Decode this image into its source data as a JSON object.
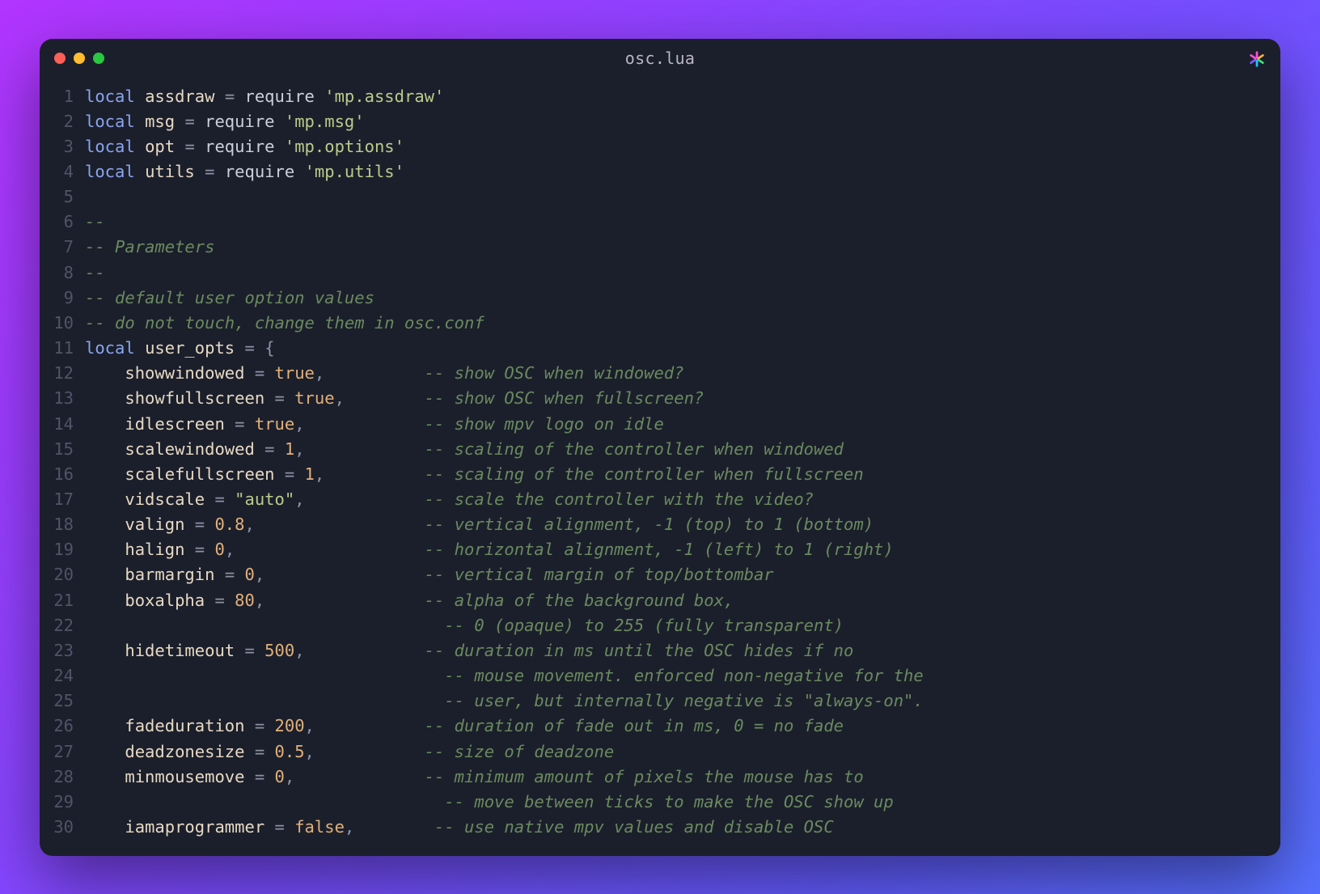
{
  "window": {
    "title": "osc.lua"
  },
  "traffic": {
    "close": "close-window",
    "min": "minimize-window",
    "max": "maximize-window"
  },
  "logo": "app-logo",
  "code": {
    "lines": [
      {
        "n": "1",
        "seg": [
          [
            "kw",
            "local"
          ],
          [
            "sp",
            " "
          ],
          [
            "ident",
            "assdraw"
          ],
          [
            "sp",
            " "
          ],
          [
            "op",
            "="
          ],
          [
            "sp",
            " "
          ],
          [
            "func",
            "require"
          ],
          [
            "sp",
            " "
          ],
          [
            "str",
            "'mp.assdraw'"
          ]
        ]
      },
      {
        "n": "2",
        "seg": [
          [
            "kw",
            "local"
          ],
          [
            "sp",
            " "
          ],
          [
            "ident",
            "msg"
          ],
          [
            "sp",
            " "
          ],
          [
            "op",
            "="
          ],
          [
            "sp",
            " "
          ],
          [
            "func",
            "require"
          ],
          [
            "sp",
            " "
          ],
          [
            "str",
            "'mp.msg'"
          ]
        ]
      },
      {
        "n": "3",
        "seg": [
          [
            "kw",
            "local"
          ],
          [
            "sp",
            " "
          ],
          [
            "ident",
            "opt"
          ],
          [
            "sp",
            " "
          ],
          [
            "op",
            "="
          ],
          [
            "sp",
            " "
          ],
          [
            "func",
            "require"
          ],
          [
            "sp",
            " "
          ],
          [
            "str",
            "'mp.options'"
          ]
        ]
      },
      {
        "n": "4",
        "seg": [
          [
            "kw",
            "local"
          ],
          [
            "sp",
            " "
          ],
          [
            "ident",
            "utils"
          ],
          [
            "sp",
            " "
          ],
          [
            "op",
            "="
          ],
          [
            "sp",
            " "
          ],
          [
            "func",
            "require"
          ],
          [
            "sp",
            " "
          ],
          [
            "str",
            "'mp.utils'"
          ]
        ]
      },
      {
        "n": "5",
        "seg": []
      },
      {
        "n": "6",
        "seg": [
          [
            "cmt",
            "--"
          ]
        ]
      },
      {
        "n": "7",
        "seg": [
          [
            "cmt",
            "-- Parameters"
          ]
        ]
      },
      {
        "n": "8",
        "seg": [
          [
            "cmt",
            "--"
          ]
        ]
      },
      {
        "n": "9",
        "seg": [
          [
            "cmt",
            "-- default user option values"
          ]
        ]
      },
      {
        "n": "10",
        "seg": [
          [
            "cmt",
            "-- do not touch, change them in osc.conf"
          ]
        ]
      },
      {
        "n": "11",
        "seg": [
          [
            "kw",
            "local"
          ],
          [
            "sp",
            " "
          ],
          [
            "ident",
            "user_opts"
          ],
          [
            "sp",
            " "
          ],
          [
            "op",
            "="
          ],
          [
            "sp",
            " "
          ],
          [
            "op",
            "{"
          ]
        ]
      },
      {
        "n": "12",
        "seg": [
          [
            "sp",
            "    "
          ],
          [
            "ident",
            "showwindowed"
          ],
          [
            "sp",
            " "
          ],
          [
            "op",
            "="
          ],
          [
            "sp",
            " "
          ],
          [
            "bool",
            "true"
          ],
          [
            "op",
            ","
          ],
          [
            "sp",
            "          "
          ],
          [
            "cmt",
            "-- show OSC when windowed?"
          ]
        ]
      },
      {
        "n": "13",
        "seg": [
          [
            "sp",
            "    "
          ],
          [
            "ident",
            "showfullscreen"
          ],
          [
            "sp",
            " "
          ],
          [
            "op",
            "="
          ],
          [
            "sp",
            " "
          ],
          [
            "bool",
            "true"
          ],
          [
            "op",
            ","
          ],
          [
            "sp",
            "        "
          ],
          [
            "cmt",
            "-- show OSC when fullscreen?"
          ]
        ]
      },
      {
        "n": "14",
        "seg": [
          [
            "sp",
            "    "
          ],
          [
            "ident",
            "idlescreen"
          ],
          [
            "sp",
            " "
          ],
          [
            "op",
            "="
          ],
          [
            "sp",
            " "
          ],
          [
            "bool",
            "true"
          ],
          [
            "op",
            ","
          ],
          [
            "sp",
            "            "
          ],
          [
            "cmt",
            "-- show mpv logo on idle"
          ]
        ]
      },
      {
        "n": "15",
        "seg": [
          [
            "sp",
            "    "
          ],
          [
            "ident",
            "scalewindowed"
          ],
          [
            "sp",
            " "
          ],
          [
            "op",
            "="
          ],
          [
            "sp",
            " "
          ],
          [
            "num",
            "1"
          ],
          [
            "op",
            ","
          ],
          [
            "sp",
            "            "
          ],
          [
            "cmt",
            "-- scaling of the controller when windowed"
          ]
        ]
      },
      {
        "n": "16",
        "seg": [
          [
            "sp",
            "    "
          ],
          [
            "ident",
            "scalefullscreen"
          ],
          [
            "sp",
            " "
          ],
          [
            "op",
            "="
          ],
          [
            "sp",
            " "
          ],
          [
            "num",
            "1"
          ],
          [
            "op",
            ","
          ],
          [
            "sp",
            "          "
          ],
          [
            "cmt",
            "-- scaling of the controller when fullscreen"
          ]
        ]
      },
      {
        "n": "17",
        "seg": [
          [
            "sp",
            "    "
          ],
          [
            "ident",
            "vidscale"
          ],
          [
            "sp",
            " "
          ],
          [
            "op",
            "="
          ],
          [
            "sp",
            " "
          ],
          [
            "str",
            "\"auto\""
          ],
          [
            "op",
            ","
          ],
          [
            "sp",
            "            "
          ],
          [
            "cmt",
            "-- scale the controller with the video?"
          ]
        ]
      },
      {
        "n": "18",
        "seg": [
          [
            "sp",
            "    "
          ],
          [
            "ident",
            "valign"
          ],
          [
            "sp",
            " "
          ],
          [
            "op",
            "="
          ],
          [
            "sp",
            " "
          ],
          [
            "num",
            "0.8"
          ],
          [
            "op",
            ","
          ],
          [
            "sp",
            "                 "
          ],
          [
            "cmt",
            "-- vertical alignment, -1 (top) to 1 (bottom)"
          ]
        ]
      },
      {
        "n": "19",
        "seg": [
          [
            "sp",
            "    "
          ],
          [
            "ident",
            "halign"
          ],
          [
            "sp",
            " "
          ],
          [
            "op",
            "="
          ],
          [
            "sp",
            " "
          ],
          [
            "num",
            "0"
          ],
          [
            "op",
            ","
          ],
          [
            "sp",
            "                   "
          ],
          [
            "cmt",
            "-- horizontal alignment, -1 (left) to 1 (right)"
          ]
        ]
      },
      {
        "n": "20",
        "seg": [
          [
            "sp",
            "    "
          ],
          [
            "ident",
            "barmargin"
          ],
          [
            "sp",
            " "
          ],
          [
            "op",
            "="
          ],
          [
            "sp",
            " "
          ],
          [
            "num",
            "0"
          ],
          [
            "op",
            ","
          ],
          [
            "sp",
            "                "
          ],
          [
            "cmt",
            "-- vertical margin of top/bottombar"
          ]
        ]
      },
      {
        "n": "21",
        "seg": [
          [
            "sp",
            "    "
          ],
          [
            "ident",
            "boxalpha"
          ],
          [
            "sp",
            " "
          ],
          [
            "op",
            "="
          ],
          [
            "sp",
            " "
          ],
          [
            "num",
            "80"
          ],
          [
            "op",
            ","
          ],
          [
            "sp",
            "                "
          ],
          [
            "cmt",
            "-- alpha of the background box,"
          ]
        ]
      },
      {
        "n": "22",
        "seg": [
          [
            "sp",
            "                                    "
          ],
          [
            "cmt",
            "-- 0 (opaque) to 255 (fully transparent)"
          ]
        ]
      },
      {
        "n": "23",
        "seg": [
          [
            "sp",
            "    "
          ],
          [
            "ident",
            "hidetimeout"
          ],
          [
            "sp",
            " "
          ],
          [
            "op",
            "="
          ],
          [
            "sp",
            " "
          ],
          [
            "num",
            "500"
          ],
          [
            "op",
            ","
          ],
          [
            "sp",
            "            "
          ],
          [
            "cmt",
            "-- duration in ms until the OSC hides if no"
          ]
        ]
      },
      {
        "n": "24",
        "seg": [
          [
            "sp",
            "                                    "
          ],
          [
            "cmt",
            "-- mouse movement. enforced non-negative for the"
          ]
        ]
      },
      {
        "n": "25",
        "seg": [
          [
            "sp",
            "                                    "
          ],
          [
            "cmt",
            "-- user, but internally negative is \"always-on\"."
          ]
        ]
      },
      {
        "n": "26",
        "seg": [
          [
            "sp",
            "    "
          ],
          [
            "ident",
            "fadeduration"
          ],
          [
            "sp",
            " "
          ],
          [
            "op",
            "="
          ],
          [
            "sp",
            " "
          ],
          [
            "num",
            "200"
          ],
          [
            "op",
            ","
          ],
          [
            "sp",
            "           "
          ],
          [
            "cmt",
            "-- duration of fade out in ms, 0 = no fade"
          ]
        ]
      },
      {
        "n": "27",
        "seg": [
          [
            "sp",
            "    "
          ],
          [
            "ident",
            "deadzonesize"
          ],
          [
            "sp",
            " "
          ],
          [
            "op",
            "="
          ],
          [
            "sp",
            " "
          ],
          [
            "num",
            "0.5"
          ],
          [
            "op",
            ","
          ],
          [
            "sp",
            "           "
          ],
          [
            "cmt",
            "-- size of deadzone"
          ]
        ]
      },
      {
        "n": "28",
        "seg": [
          [
            "sp",
            "    "
          ],
          [
            "ident",
            "minmousemove"
          ],
          [
            "sp",
            " "
          ],
          [
            "op",
            "="
          ],
          [
            "sp",
            " "
          ],
          [
            "num",
            "0"
          ],
          [
            "op",
            ","
          ],
          [
            "sp",
            "             "
          ],
          [
            "cmt",
            "-- minimum amount of pixels the mouse has to"
          ]
        ]
      },
      {
        "n": "29",
        "seg": [
          [
            "sp",
            "                                    "
          ],
          [
            "cmt",
            "-- move between ticks to make the OSC show up"
          ]
        ]
      },
      {
        "n": "30",
        "seg": [
          [
            "sp",
            "    "
          ],
          [
            "ident",
            "iamaprogrammer"
          ],
          [
            "sp",
            " "
          ],
          [
            "op",
            "="
          ],
          [
            "sp",
            " "
          ],
          [
            "bool",
            "false"
          ],
          [
            "op",
            ","
          ],
          [
            "sp",
            "        "
          ],
          [
            "cmt",
            "-- use native mpv values and disable OSC"
          ]
        ]
      }
    ]
  }
}
